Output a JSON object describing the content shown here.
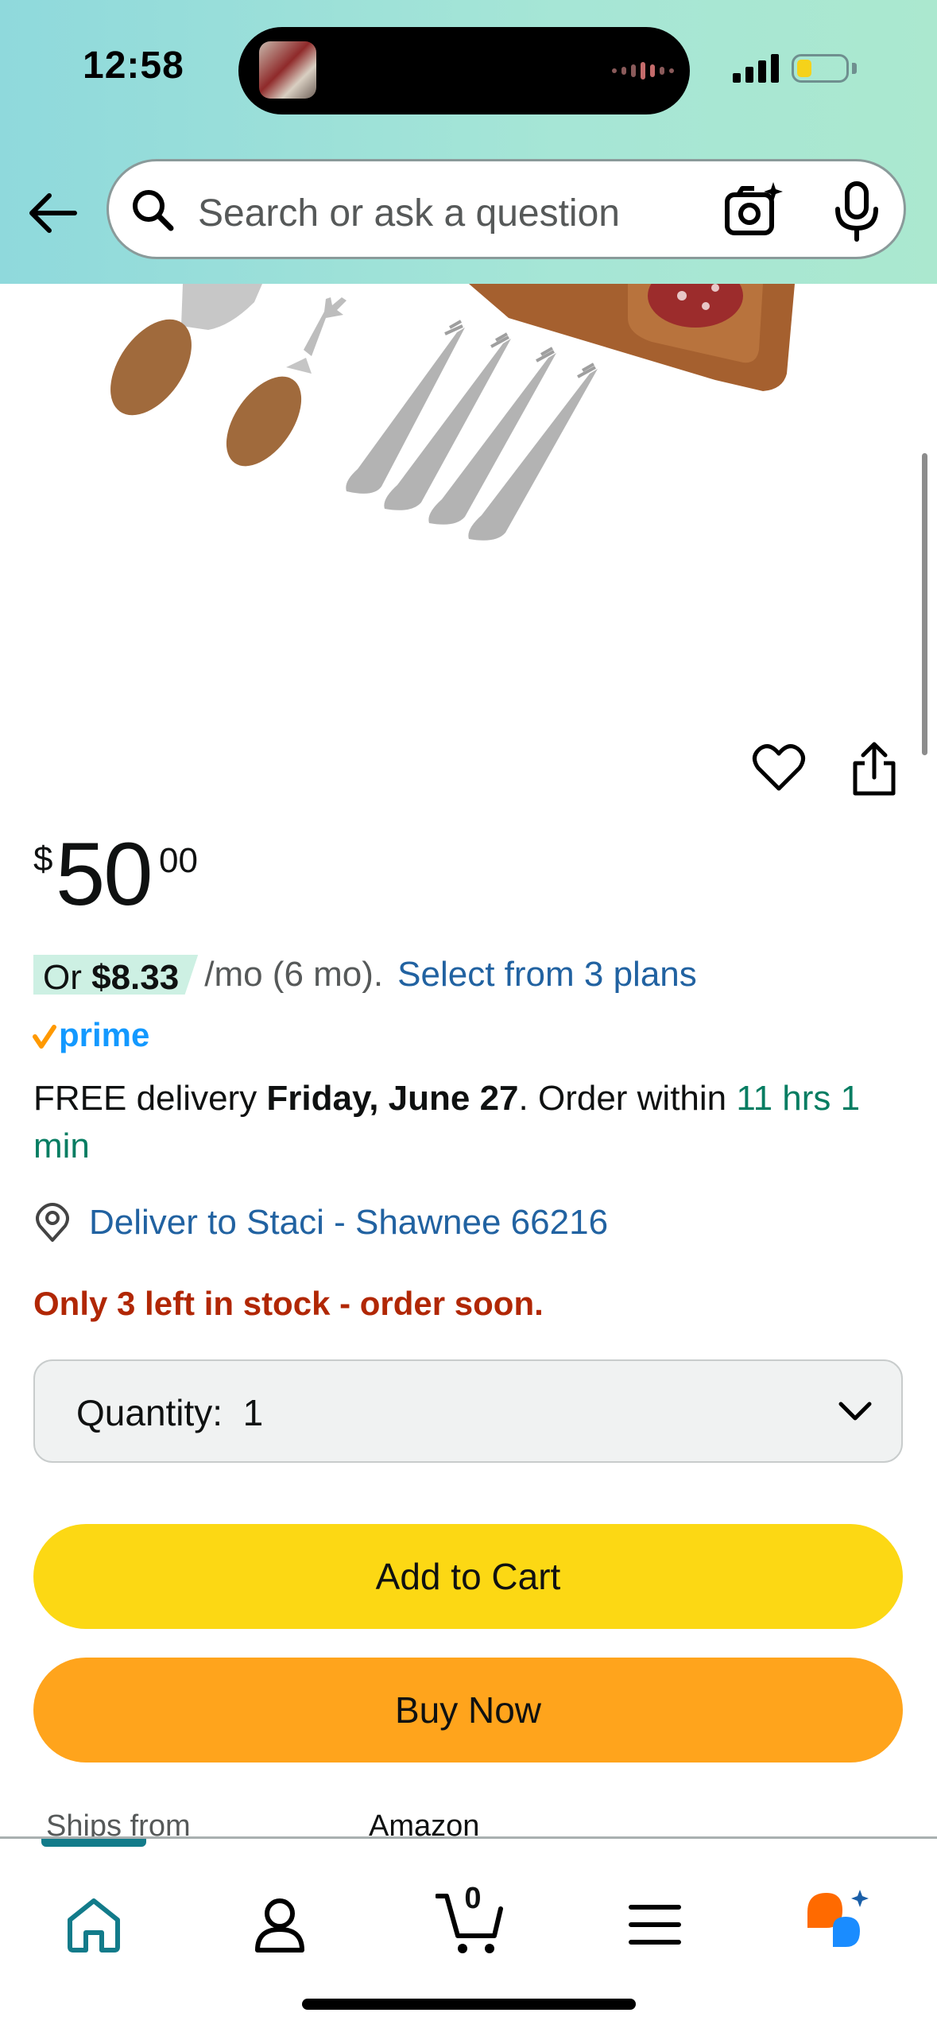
{
  "status_bar": {
    "time": "12:58"
  },
  "header": {
    "search_placeholder": "Search or ask a question"
  },
  "product": {
    "price": {
      "symbol": "$",
      "whole": "50",
      "fraction": "00"
    },
    "financing": {
      "prefix": "Or ",
      "amount": "$8.33",
      "term": "/mo (6 mo).",
      "link": "Select from 3 plans"
    },
    "prime_label": "prime",
    "delivery": {
      "text1": "FREE delivery ",
      "date": "Friday, June 27",
      "text2": ". Order within ",
      "countdown": "11 hrs 1 min"
    },
    "deliver_to": "Deliver to Staci - Shawnee 66216",
    "stock": "Only 3 left in stock - order soon.",
    "quantity_label": "Quantity:",
    "quantity_value": "1",
    "add_to_cart": "Add to Cart",
    "buy_now": "Buy Now",
    "ships_from_label": "Ships from",
    "ships_from_value": "Amazon"
  },
  "bottom_nav": {
    "items": [
      "home-icon",
      "account-icon",
      "cart-icon",
      "menu-icon",
      "rufus-icon"
    ],
    "cart_count": "0"
  },
  "colors": {
    "header_gradient_start": "#8fd9dc",
    "header_gradient_end": "#abe8cf",
    "add_to_cart": "#fcd814",
    "buy_now": "#ffa41c",
    "link": "#2162a1",
    "stock_warning": "#b12704",
    "delivery_green": "#067d62",
    "nav_active": "#127b8a"
  }
}
